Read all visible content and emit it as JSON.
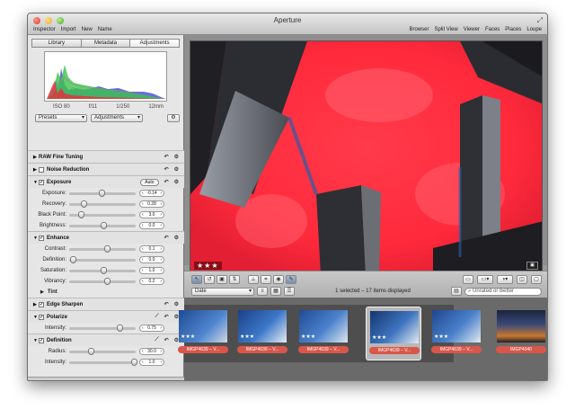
{
  "window": {
    "title": "Aperture"
  },
  "toolbar": {
    "left": [
      "Inspector",
      "Import",
      "New",
      "Name"
    ],
    "right": [
      "Browser",
      "Split View",
      "Viewer",
      "Faces",
      "Places",
      "Loupe"
    ]
  },
  "inspector": {
    "tabs": [
      "Library",
      "Metadata",
      "Adjustments"
    ],
    "active_tab": "Adjustments",
    "histogram_meta": [
      "ISO 80",
      "f/11",
      "1/250",
      "12mm"
    ],
    "presets_label": "Presets",
    "adjustments_label": "Adjustments",
    "gear": "⚙",
    "bricks": {
      "raw": {
        "label": "RAW Fine Tuning"
      },
      "noise": {
        "label": "Noise Reduction"
      },
      "exposure": {
        "label": "Exposure",
        "auto": "Auto",
        "params": [
          {
            "label": "Exposure:",
            "value": "-0.14",
            "pos": 0.47
          },
          {
            "label": "Recovery:",
            "value": "0.28",
            "pos": 0.18
          },
          {
            "label": "Black Point:",
            "value": "3.0",
            "pos": 0.14
          },
          {
            "label": "Brightness:",
            "value": "0.0",
            "pos": 0.5
          }
        ]
      },
      "enhance": {
        "label": "Enhance",
        "params": [
          {
            "label": "Contrast:",
            "value": "0.1",
            "pos": 0.55
          },
          {
            "label": "Definition:",
            "value": "0.0",
            "pos": 0.02
          },
          {
            "label": "Saturation:",
            "value": "1.0",
            "pos": 0.5
          },
          {
            "label": "Vibrancy:",
            "value": "0.2",
            "pos": 0.55
          }
        ],
        "tint": "Tint"
      },
      "edge": {
        "label": "Edge Sharpen"
      },
      "polarize": {
        "label": "Polarize",
        "params": [
          {
            "label": "Intensity:",
            "value": "0.75",
            "pos": 0.75
          }
        ]
      },
      "definition": {
        "label": "Definition",
        "params": [
          {
            "label": "Radius:",
            "value": "30.0",
            "pos": 0.3
          },
          {
            "label": "Intensity:",
            "value": "1.0",
            "pos": 0.98
          }
        ]
      }
    }
  },
  "viewer": {
    "rating": "★★★",
    "badge": "▣"
  },
  "controls": {
    "sort_label": "Date",
    "status": "1 selected – 17 items displayed",
    "filter": "Unrated or Better"
  },
  "browser": {
    "thumbnails": [
      {
        "name": "IMGP4639 – V...",
        "stars": "★★★"
      },
      {
        "name": "IMGP4639 – V...",
        "stars": "★★★"
      },
      {
        "name": "IMGP4639 – V...",
        "stars": "★★★"
      },
      {
        "name": "IMGP4639 – V...",
        "stars": "★★★"
      },
      {
        "name": "IMGP4040",
        "stars": ""
      }
    ]
  },
  "colors": {
    "accent_red": "#d8574a",
    "photo_red": "#ff2b3e",
    "sky_blue": "#2a5fa8"
  }
}
